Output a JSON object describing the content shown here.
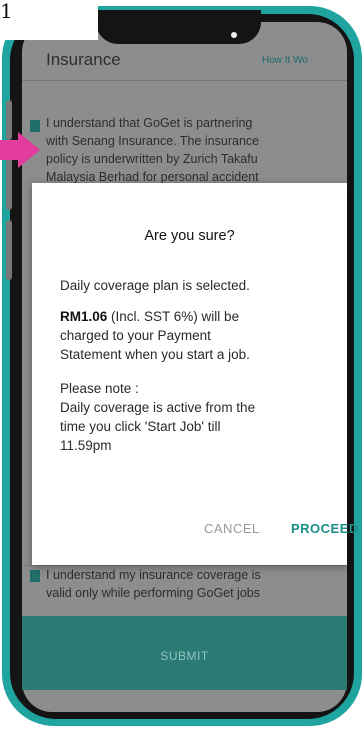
{
  "corner_label": "1",
  "app": {
    "title": "Insurance",
    "how_it_works": "How It Wo",
    "paragraph_lines": [
      "I understand that GoGet is partnering",
      "with Senang Insurance. The insurance",
      "policy is underwritten by Zurich Takafu",
      "Malaysia Berhad for personal accident"
    ],
    "bottom_lines": [
      "I understand my insurance coverage is",
      "valid only while performing GoGet jobs"
    ],
    "submit_label": "SUBMIT"
  },
  "dialog": {
    "title": "Are you sure?",
    "plan_text": "Daily coverage plan is selected.",
    "amount": "RM1.06",
    "amount_suffix": " (Incl. SST 6%) will be",
    "charge_line_2": "charged to your Payment",
    "charge_line_3": "Statement when you start a job.",
    "note_label": "Please note :",
    "note_line_1": "Daily coverage is active from the",
    "note_line_2": "time you click 'Start Job' till",
    "note_line_3": "11.59pm",
    "cancel_label": "CANCEL",
    "proceed_label": "PROCEED"
  },
  "colors": {
    "frame_teal": "#1fa4a0",
    "accent": "#1c8d89",
    "arrow_pink": "#e23c9e"
  }
}
